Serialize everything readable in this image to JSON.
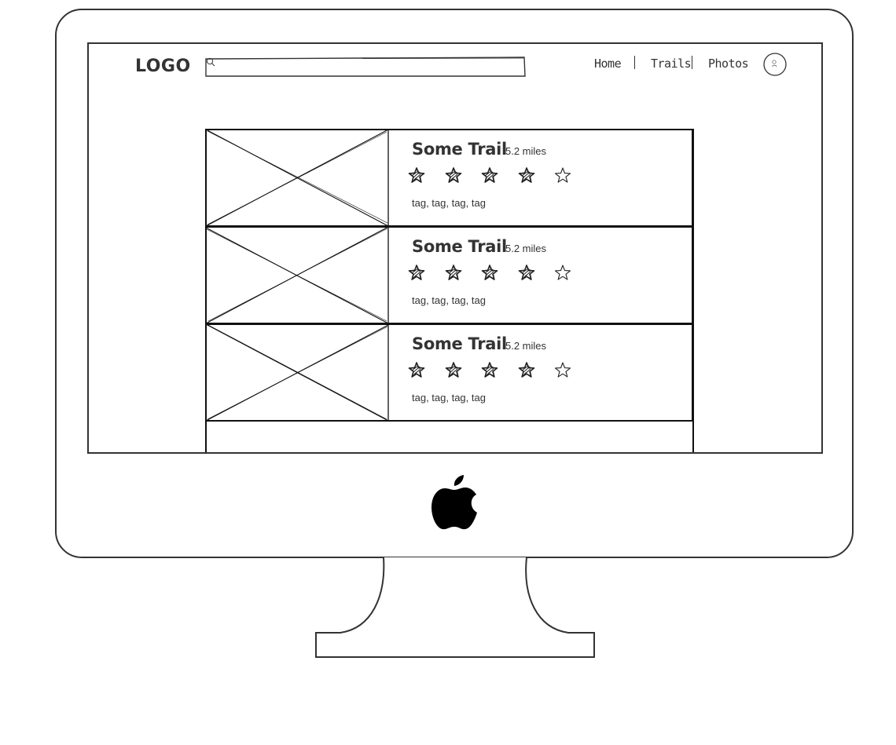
{
  "header": {
    "logo": "LOGO",
    "search": {
      "placeholder": "",
      "value": ""
    },
    "nav": [
      {
        "label": "Home"
      },
      {
        "label": "Trails"
      },
      {
        "label": "Photos"
      }
    ]
  },
  "trails": [
    {
      "name": "Some Trail",
      "distance": "5.2 miles",
      "rating": 4,
      "max_rating": 5,
      "tags": "tag, tag, tag, tag"
    },
    {
      "name": "Some Trail",
      "distance": "5.2 miles",
      "rating": 4,
      "max_rating": 5,
      "tags": "tag, tag, tag, tag"
    },
    {
      "name": "Some Trail",
      "distance": "5.2 miles",
      "rating": 4,
      "max_rating": 5,
      "tags": "tag, tag, tag, tag"
    }
  ],
  "icons": {
    "search": "search-icon",
    "avatar": "user-icon",
    "star_filled": "star-filled-icon",
    "star_empty": "star-empty-icon",
    "brand": "apple-logo-icon",
    "image_placeholder": "image-placeholder-icon"
  },
  "colors": {
    "line": "#333333",
    "frame": "#111111",
    "background": "#ffffff"
  }
}
